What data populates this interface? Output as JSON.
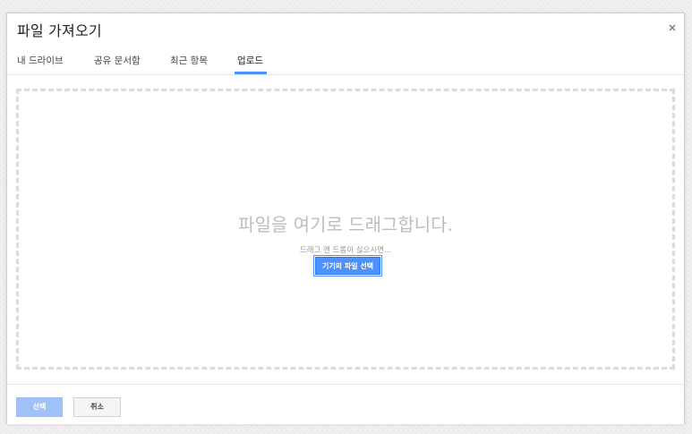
{
  "dialog": {
    "title": "파일 가져오기",
    "close_icon": "close-icon"
  },
  "tabs": [
    {
      "label": "내 드라이브",
      "active": false
    },
    {
      "label": "공유 문서함",
      "active": false
    },
    {
      "label": "최근 항목",
      "active": false
    },
    {
      "label": "업로드",
      "active": true
    }
  ],
  "upload": {
    "drop_title": "파일을 여기로 드래그합니다.",
    "drop_subtitle": "드래그 앤 드롭이 싫으시면...",
    "pick_button": "기기의 파일 선택"
  },
  "footer": {
    "select_label": "선택",
    "cancel_label": "취소"
  },
  "colors": {
    "accent": "#4d90fe",
    "accent_disabled": "#a0c2f9",
    "dropzone_border": "#dcdcdc"
  }
}
